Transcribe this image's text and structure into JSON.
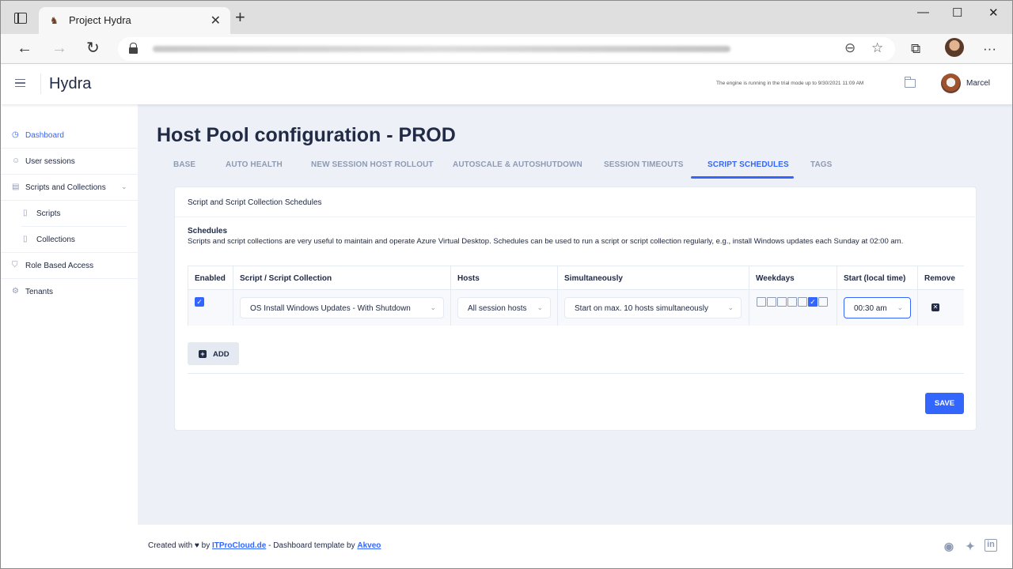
{
  "browser": {
    "tab_title": "Project Hydra",
    "tab_close": "✕",
    "new_tab": "+",
    "window_controls": {
      "minimize": "—",
      "maximize": "☐",
      "close": "✕"
    },
    "nav": {
      "back": "←",
      "forward": "→",
      "reload": "↻"
    },
    "icons": {
      "zoom": "zoom-out-icon",
      "favorite": "favorite-star-icon",
      "collections": "collections-icon",
      "menu": "more-icon"
    },
    "more": "···"
  },
  "app": {
    "brand": "Hydra",
    "trial_notice": "The engine is running in the trial mode up to 9/30/2021 11:09 AM",
    "user_name": "Marcel"
  },
  "sidebar": {
    "items": [
      {
        "label": "Dashboard",
        "active": true,
        "icon": "clock-icon"
      },
      {
        "label": "User sessions",
        "icon": "users-icon"
      },
      {
        "label": "Scripts and Collections",
        "icon": "archive-icon",
        "expanded": true
      },
      {
        "label": "Scripts",
        "icon": "file-icon"
      },
      {
        "label": "Collections",
        "icon": "file-icon"
      },
      {
        "label": "Role Based Access",
        "icon": "shield-icon"
      },
      {
        "label": "Tenants",
        "icon": "settings-icon"
      }
    ],
    "chevron": "⌄"
  },
  "page": {
    "title": "Host Pool configuration - PROD",
    "tabs": [
      "BASE",
      "AUTO HEALTH",
      "NEW SESSION HOST ROLLOUT",
      "AUTOSCALE & AUTOSHUTDOWN",
      "SESSION TIMEOUTS",
      "SCRIPT SCHEDULES",
      "TAGS"
    ],
    "active_tab": "SCRIPT SCHEDULES"
  },
  "card": {
    "header": "Script and Script Collection Schedules",
    "section_title": "Schedules",
    "section_desc": "Scripts and script collections are very useful to maintain and operate Azure Virtual Desktop. Schedules can be used to run a script or script collection regularly, e.g., install Windows updates each Sunday at 02:00 am.",
    "table": {
      "headers": [
        "Enabled",
        "Script / Script Collection",
        "Hosts",
        "Simultaneously",
        "Weekdays",
        "Start (local time)",
        "Remove"
      ],
      "row": {
        "enabled": true,
        "script": "OS Install Windows Updates - With Shutdown",
        "hosts": "All session hosts",
        "simultaneously": "Start on max. 10 hosts simultaneously",
        "weekdays": [
          false,
          false,
          false,
          false,
          false,
          true,
          false
        ],
        "start": "00:30 am"
      }
    },
    "add_label": "ADD",
    "save_label": "SAVE",
    "check_glyph": "✓",
    "dropdown_glyph": "⌄",
    "remove_glyph": "✕",
    "add_glyph": "+"
  },
  "footer": {
    "prefix": "Created with ♥ by ",
    "link1": "ITProCloud.de",
    "middle": " - Dashboard template by ",
    "link2": "Akveo",
    "social": [
      "github-icon",
      "twitter-icon",
      "linkedin-icon"
    ]
  },
  "colors": {
    "accent": "#3366ff",
    "text": "#222b45",
    "muted": "#8f9bb3",
    "bg": "#edf1f7"
  }
}
